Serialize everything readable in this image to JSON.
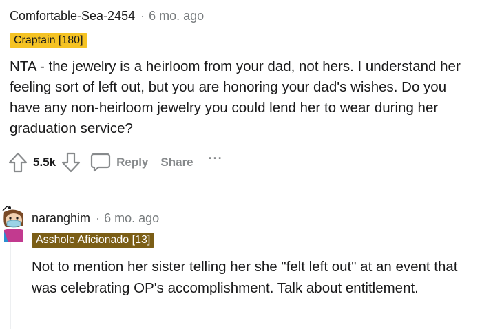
{
  "top_comment": {
    "username": "Comfortable-Sea-2454",
    "separator": "·",
    "timestamp": "6 mo. ago",
    "flair": "Craptain [180]",
    "body": "NTA - the jewelry is a heirloom from your dad, not hers. I understand her feeling sort of left out, but you are honoring your dad's wishes. Do you have any non-heirloom jewelry you could lend her to wear during her graduation service?",
    "score": "5.5k",
    "actions": {
      "reply": "Reply",
      "share": "Share",
      "more": "···"
    }
  },
  "reply_comment": {
    "username": "naranghim",
    "separator": "·",
    "timestamp": "6 mo. ago",
    "flair": "Asshole Aficionado [13]",
    "body": "Not to mention her sister telling her she \"felt left out\" at an event that was celebrating OP's accomplishment. Talk about entitlement."
  },
  "icons": {
    "upvote": "upvote-arrow-icon",
    "downvote": "downvote-arrow-icon",
    "reply": "speech-bubble-icon",
    "avatar": "snoo-avatar"
  },
  "colors": {
    "flair_yellow": "#f5c324",
    "flair_olive": "#7b5e16",
    "meta_gray": "#787c7e",
    "action_gray": "#878a8c",
    "text": "#1a1a1b"
  }
}
